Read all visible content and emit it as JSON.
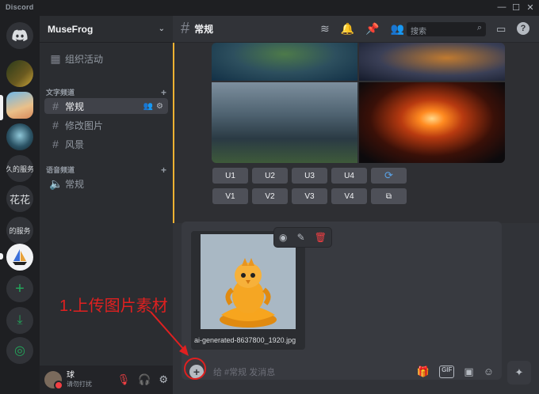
{
  "titlebar": {
    "app_name": "Discord",
    "minimize": "—",
    "maximize": "☐",
    "close": "✕"
  },
  "servers": [
    {
      "label": "",
      "icon": "discord-logo-icon"
    },
    {
      "label": ""
    },
    {
      "label": ""
    },
    {
      "label": ""
    },
    {
      "label": "久的服务"
    },
    {
      "label": "花花"
    },
    {
      "label": "的服务"
    },
    {
      "label": ""
    },
    {
      "label": "+",
      "icon": "add-server-icon"
    },
    {
      "label": "⤓",
      "icon": "download-icon"
    },
    {
      "label": "◎",
      "icon": "explore-icon"
    }
  ],
  "guild": {
    "name": "MuseFrog"
  },
  "sidebar": {
    "events_label": "组织活动",
    "text_category": "文字频道",
    "voice_category": "语音频道",
    "text_channels": [
      "常规",
      "修改图片",
      "风景"
    ],
    "voice_channels": [
      "常规"
    ]
  },
  "user": {
    "name": "球",
    "status": "请勿打扰"
  },
  "header": {
    "channel": "常规",
    "search_placeholder": "搜索"
  },
  "upscale_buttons": [
    "U1",
    "U2",
    "U3",
    "U4"
  ],
  "variation_buttons": [
    "V1",
    "V2",
    "V3",
    "V4"
  ],
  "attachment": {
    "filename": "ai-generated-8637800_1920.jpg"
  },
  "composer": {
    "placeholder": "给 #常规 发消息"
  },
  "annotation": {
    "text": "1.上传图片素材"
  },
  "colors": {
    "accent_red": "#e02020",
    "blurple": "#5865f2",
    "embed_border": "#f0b232"
  }
}
